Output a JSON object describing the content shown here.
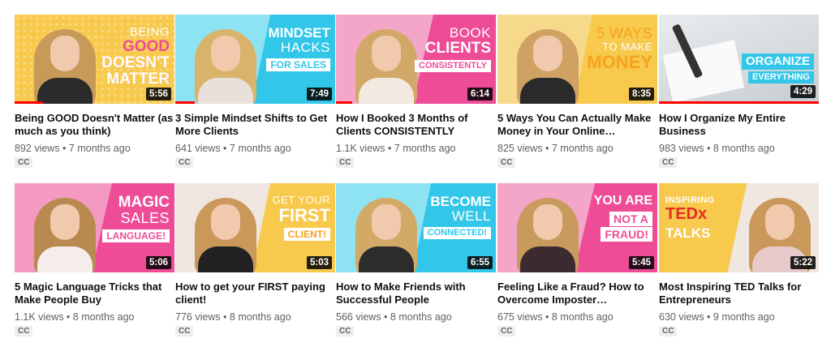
{
  "colors": {
    "pink": "#ee4c97",
    "yellow": "#f8c950",
    "cyan": "#32c7e8",
    "progress": "#ff0000"
  },
  "videos": [
    {
      "thumb": {
        "line1": "BEING",
        "line2": "GOOD",
        "line3": "DOESN'T MATTER",
        "bg": "#f7c94d",
        "panel": "#f7c94d",
        "accent": "#ee4c97"
      },
      "duration": "5:56",
      "title": "Being GOOD Doesn't Matter (as much as you think)",
      "meta": "892 views • 7 months ago",
      "cc": "CC",
      "watched": 0.18
    },
    {
      "thumb": {
        "line1": "MINDSET",
        "line2": "HACKS",
        "line3": "FOR SALES",
        "bg": "#8ee3f2",
        "panel": "#32c7e8",
        "accent": "#32c7e8"
      },
      "duration": "7:49",
      "title": "3 Simple Mindset Shifts to Get More Clients",
      "meta": "641 views • 7 months ago",
      "cc": "CC",
      "watched": 0.12
    },
    {
      "thumb": {
        "line1": "BOOK",
        "line2": "CLIENTS",
        "line3": "CONSISTENTLY",
        "bg": "#f4a6c8",
        "panel": "#ee4c97",
        "accent": "#ee4c97"
      },
      "duration": "6:14",
      "title": "How I Booked 3 Months of Clients CONSISTENTLY",
      "meta": "1.1K views • 7 months ago",
      "cc": "CC",
      "watched": 0.1
    },
    {
      "thumb": {
        "line1": "5 WAYS",
        "line2": "TO MAKE",
        "line3": "MONEY",
        "bg": "#f7d98c",
        "panel": "#f7c94d",
        "accent": "#f7a21b"
      },
      "duration": "8:35",
      "title": "5 Ways You Can Actually Make Money in Your Online…",
      "meta": "825 views • 7 months ago",
      "cc": "CC",
      "watched": 0
    },
    {
      "thumb": {
        "line1": "",
        "line2": "ORGANIZE",
        "line3": "EVERYTHING",
        "bg": "#d7dde0",
        "panel": "#32c7e8",
        "accent": "#32c7e8"
      },
      "duration": "4:29",
      "title": "How I Organize My Entire Business",
      "meta": "983 views • 8 months ago",
      "cc": "CC",
      "watched": 1.0
    },
    {
      "thumb": {
        "line1": "MAGIC",
        "line2": "SALES",
        "line3": "LANGUAGE!",
        "bg": "#ee4c97",
        "panel": "#ee4c97",
        "accent": "#ee4c97"
      },
      "duration": "5:06",
      "title": "5 Magic Language Tricks that Make People Buy",
      "meta": "1.1K views • 8 months ago",
      "cc": "CC",
      "watched": 0
    },
    {
      "thumb": {
        "line1": "GET YOUR",
        "line2": "FIRST",
        "line3": "CLIENT!",
        "bg": "#f7c94d",
        "panel": "#f7c94d",
        "accent": "#f7a21b"
      },
      "duration": "5:03",
      "title": "How to get your FIRST paying client!",
      "meta": "776 views • 8 months ago",
      "cc": "CC",
      "watched": 0
    },
    {
      "thumb": {
        "line1": "BECOME",
        "line2": "WELL",
        "line3": "CONNECTED!",
        "bg": "#8ee3f2",
        "panel": "#32c7e8",
        "accent": "#32c7e8"
      },
      "duration": "6:55",
      "title": "How to Make Friends with Successful People",
      "meta": "566 views • 8 months ago",
      "cc": "CC",
      "watched": 0
    },
    {
      "thumb": {
        "line1": "YOU ARE",
        "line2": "NOT A",
        "line3": "FRAUD!",
        "bg": "#f4a6c8",
        "panel": "#ee4c97",
        "accent": "#ee4c97"
      },
      "duration": "5:45",
      "title": "Feeling Like a Fraud? How to Overcome Imposter…",
      "meta": "675 views • 8 months ago",
      "cc": "CC",
      "watched": 0
    },
    {
      "thumb": {
        "line1": "INSPIRING",
        "line2": "TEDx",
        "line3": "TALKS",
        "bg": "#f7c94d",
        "panel": "#f7c94d",
        "accent": "#e62b1e"
      },
      "duration": "5:22",
      "title": "Most Inspiring TED Talks for Entrepreneurs",
      "meta": "630 views • 9 months ago",
      "cc": "CC",
      "watched": 0
    }
  ]
}
